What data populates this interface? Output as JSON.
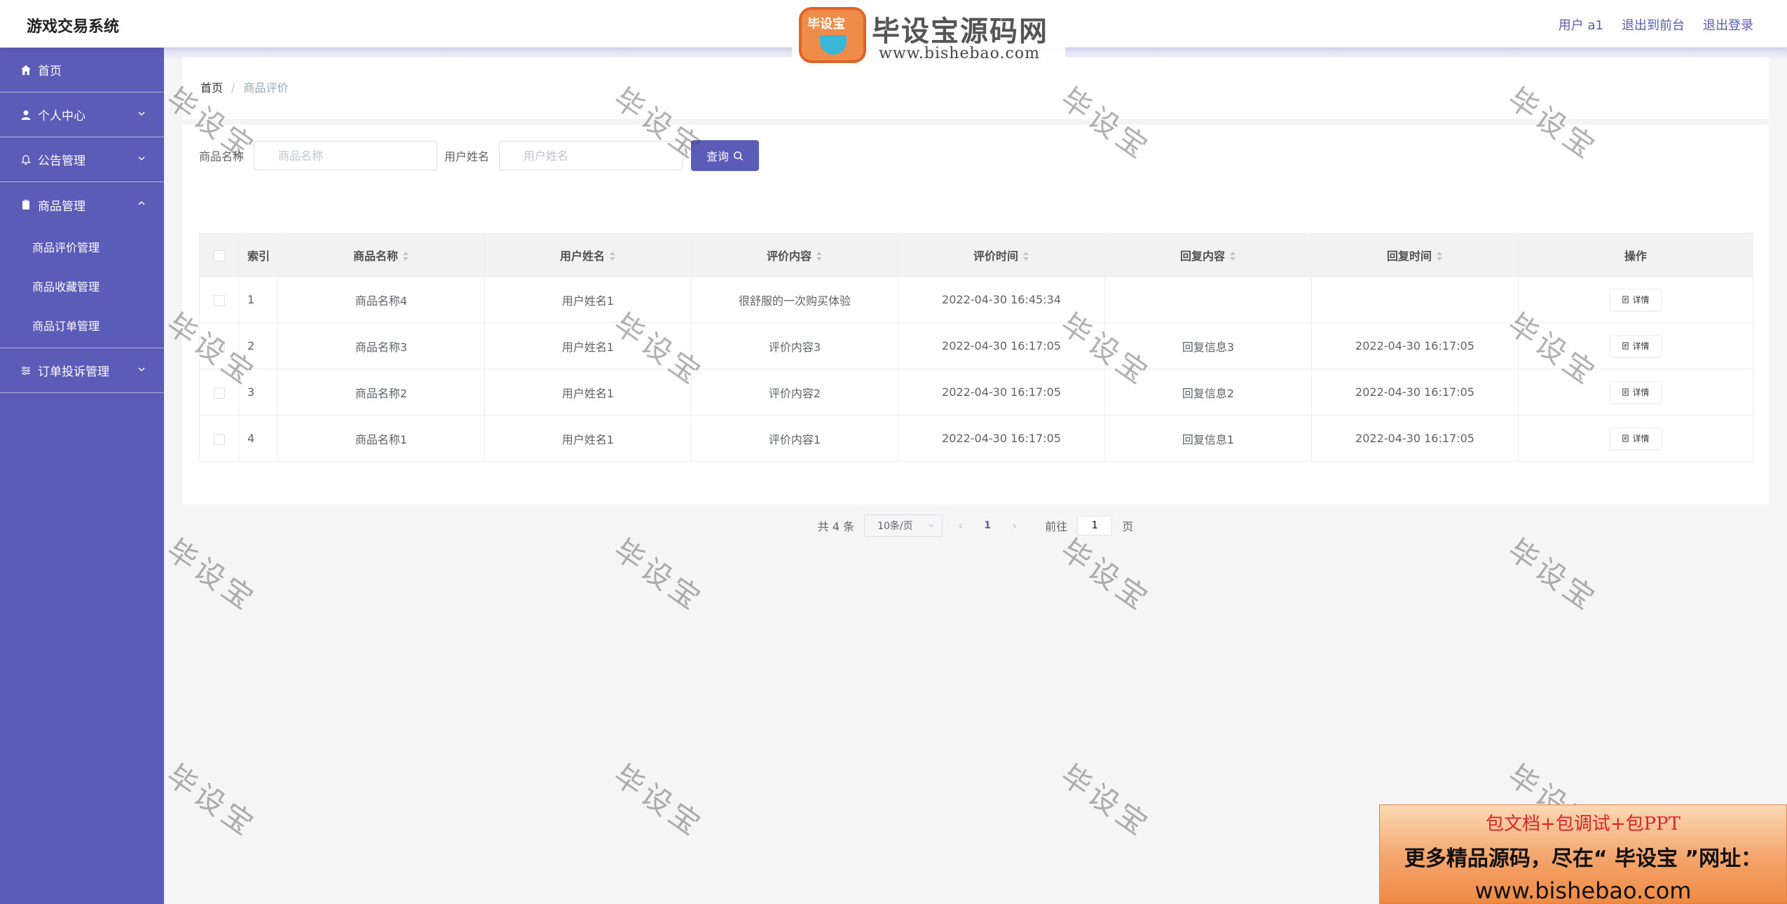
{
  "header": {
    "app_title": "游戏交易系统",
    "user_label": "用户 a1",
    "back_to_front": "退出到前台",
    "logout": "退出登录"
  },
  "sidebar": {
    "home": "首页",
    "personal_center": "个人中心",
    "announcement": "公告管理",
    "goods": "商品管理",
    "goods_sub": [
      "商品评价管理",
      "商品收藏管理",
      "商品订单管理"
    ],
    "complaint": "订单投诉管理"
  },
  "breadcrumb": {
    "home": "首页",
    "sep": "/",
    "current": "商品评价"
  },
  "search": {
    "goods_label": "商品名称",
    "goods_placeholder": "商品名称",
    "user_label": "用户姓名",
    "user_placeholder": "用户姓名",
    "query_button": "查询"
  },
  "table": {
    "columns": [
      "索引",
      "商品名称",
      "用户姓名",
      "评价内容",
      "评价时间",
      "回复内容",
      "回复时间",
      "操作"
    ],
    "detail_label": "详情",
    "rows": [
      {
        "index": "1",
        "goods": "商品名称4",
        "user": "用户姓名1",
        "content": "很舒服的一次购买体验",
        "time": "2022-04-30 16:45:34",
        "reply": "",
        "reply_time": ""
      },
      {
        "index": "2",
        "goods": "商品名称3",
        "user": "用户姓名1",
        "content": "评价内容3",
        "time": "2022-04-30 16:17:05",
        "reply": "回复信息3",
        "reply_time": "2022-04-30 16:17:05"
      },
      {
        "index": "3",
        "goods": "商品名称2",
        "user": "用户姓名1",
        "content": "评价内容2",
        "time": "2022-04-30 16:17:05",
        "reply": "回复信息2",
        "reply_time": "2022-04-30 16:17:05"
      },
      {
        "index": "4",
        "goods": "商品名称1",
        "user": "用户姓名1",
        "content": "评价内容1",
        "time": "2022-04-30 16:17:05",
        "reply": "回复信息1",
        "reply_time": "2022-04-30 16:17:05"
      }
    ]
  },
  "pagination": {
    "total": "共 4 条",
    "page_size": "10条/页",
    "current_page": "1",
    "goto_label": "前往",
    "goto_value": "1",
    "page_suffix": "页"
  },
  "watermark": {
    "text": "毕设宝"
  },
  "logo": {
    "badge": "毕设宝",
    "title": "毕设宝源码网",
    "url": "www.bishebao.com"
  },
  "ad": {
    "line1": "包文档+包调试+包PPT",
    "line2": "更多精品源码，尽在“ 毕设宝 ”网址：",
    "line3": "www.bishebao.com"
  },
  "colors": {
    "primary": "#5b5bb8",
    "background": "#f5f5f5"
  }
}
